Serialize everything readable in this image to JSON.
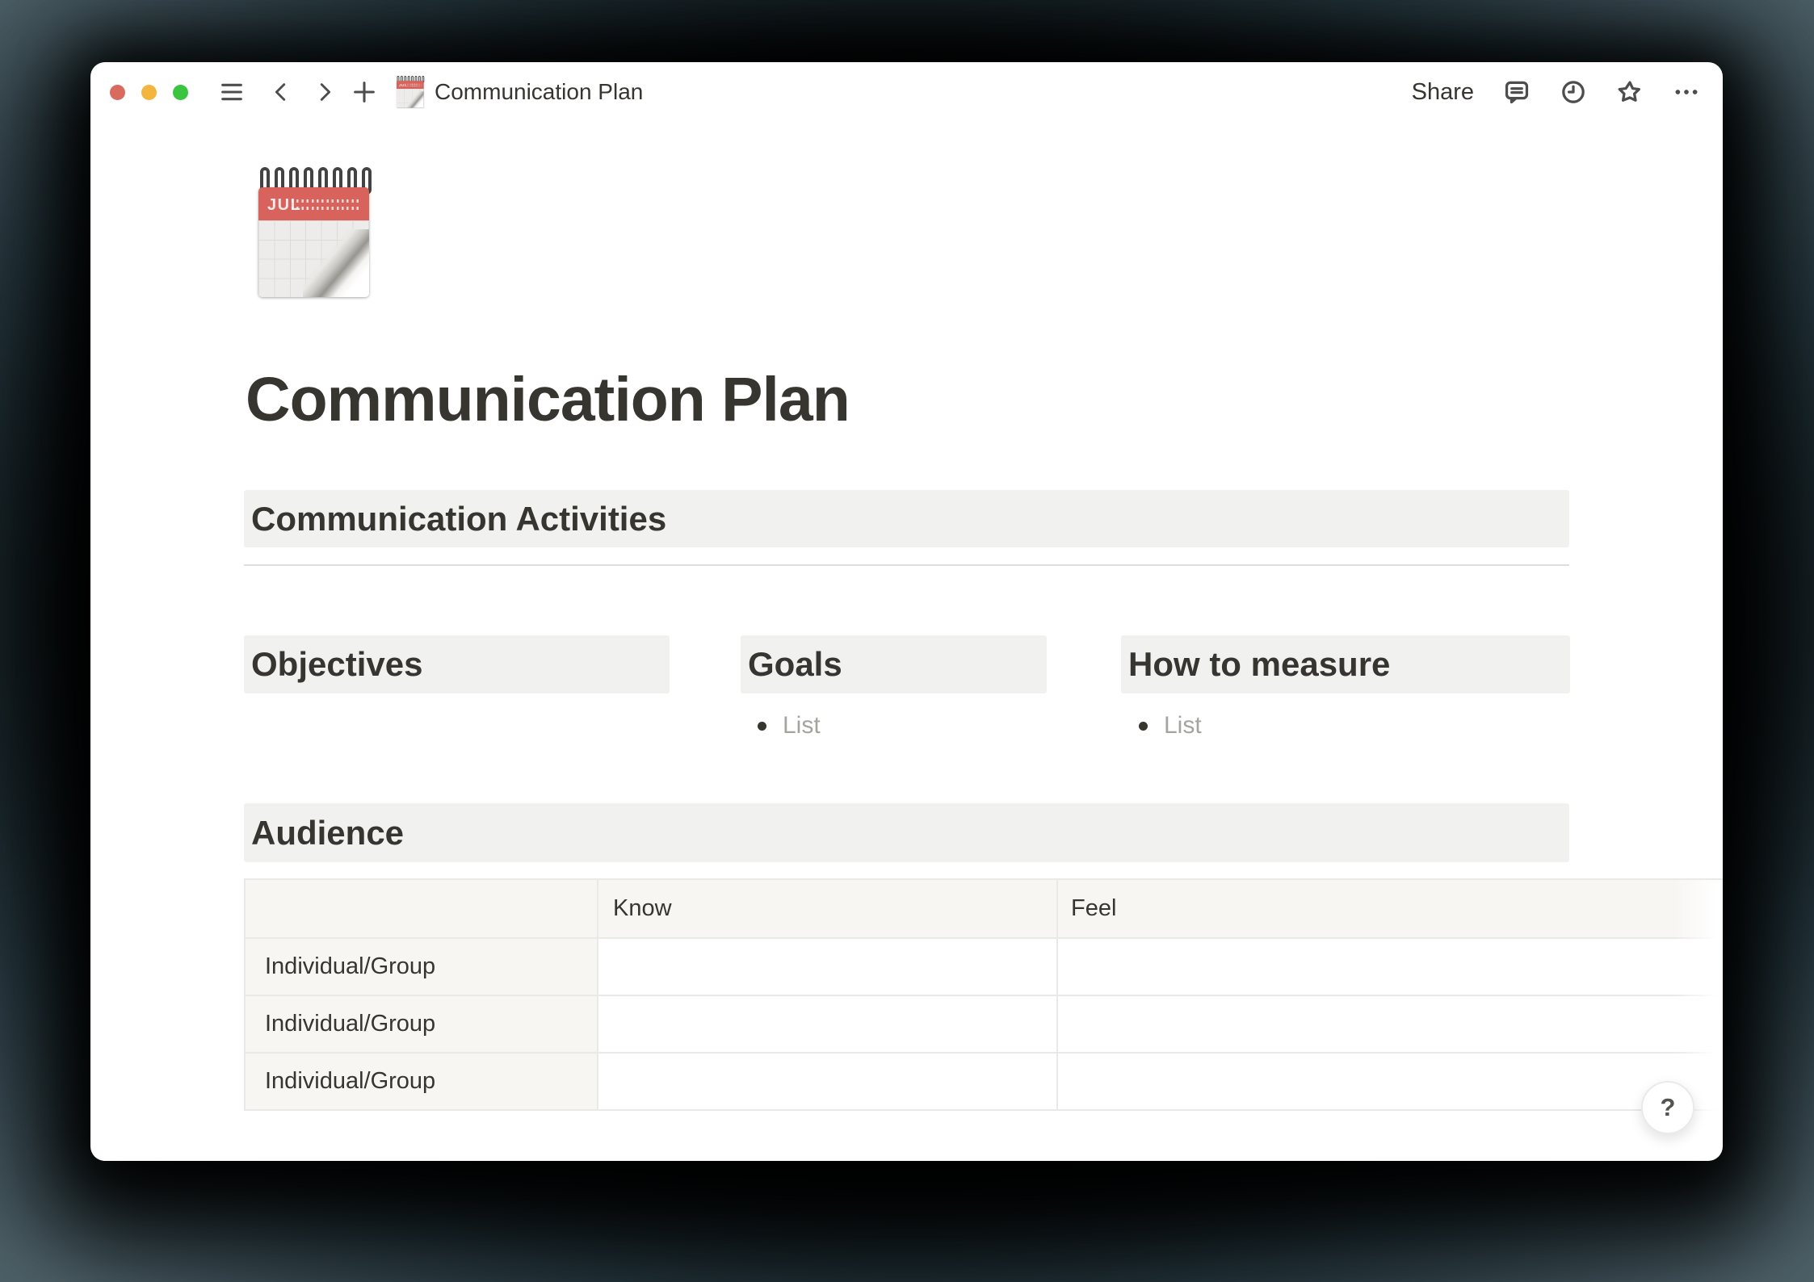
{
  "toolbar": {
    "title": "Communication Plan",
    "share_label": "Share"
  },
  "page": {
    "icon": {
      "month": "JUL"
    },
    "title": "Communication Plan",
    "activities_heading": "Communication Activities",
    "columns": [
      {
        "heading": "Objectives",
        "items": []
      },
      {
        "heading": "Goals",
        "items": [
          "List"
        ]
      },
      {
        "heading": "How to measure",
        "items": [
          "List"
        ]
      }
    ],
    "audience_heading": "Audience",
    "table": {
      "columns": [
        "",
        "Know",
        "Feel"
      ],
      "rows": [
        [
          "Individual/Group",
          "",
          ""
        ],
        [
          "Individual/Group",
          "",
          ""
        ],
        [
          "Individual/Group",
          "",
          ""
        ]
      ]
    },
    "help_label": "?"
  },
  "colors": {
    "traffic_red": "#D96A5E",
    "traffic_yellow": "#F3B53D",
    "traffic_green": "#3BC43F",
    "heading_block_bg": "#F1F1EF",
    "table_header_bg": "#F7F6F3",
    "table_border": "#E9E9E7",
    "text": "#37352F",
    "placeholder_text": "#A5A49F",
    "emoji_header_red": "#D8635C",
    "desktop_bg": "#4D6067"
  }
}
